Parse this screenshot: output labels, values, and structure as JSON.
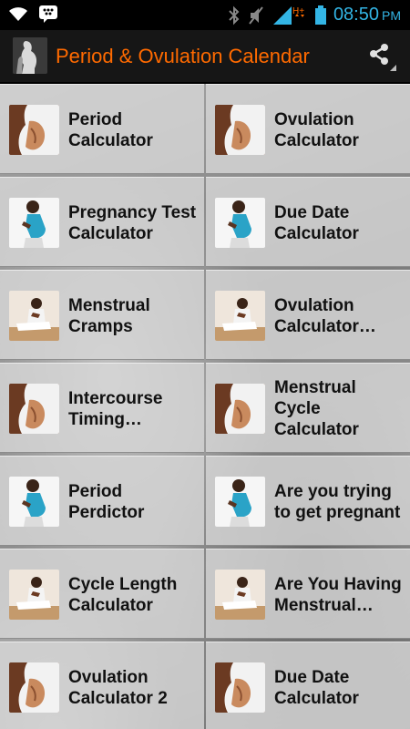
{
  "status_bar": {
    "time": "08:50",
    "ampm": "PM",
    "network": "H+",
    "icons": [
      "wifi-icon",
      "bbm-icon",
      "bluetooth-icon",
      "mute-icon",
      "signal-icon",
      "battery-icon"
    ]
  },
  "action_bar": {
    "title": "Period & Ovulation Calendar",
    "share_icon": "share-icon"
  },
  "colors": {
    "title": "#ff6a00",
    "clock": "#33b5e5",
    "tile_bg": "#d7d7d7"
  },
  "tiles": [
    {
      "label": "Period\nCalculator",
      "image": "belly-photo"
    },
    {
      "label": "Ovulation\nCalculator",
      "image": "belly-photo"
    },
    {
      "label": "Pregnancy Test\nCalculator",
      "image": "pregnant-woman-photo"
    },
    {
      "label": "Due Date\nCalculator",
      "image": "pregnant-woman-photo"
    },
    {
      "label": "Menstrual\nCramps",
      "image": "woman-sitting-photo"
    },
    {
      "label": "Ovulation\nCalculator…",
      "image": "woman-sitting-photo"
    },
    {
      "label": "Intercourse\nTiming…",
      "image": "belly-photo"
    },
    {
      "label": "Menstrual Cycle\nCalculator",
      "image": "belly-photo"
    },
    {
      "label": "Period Perdictor",
      "image": "pregnant-woman-photo"
    },
    {
      "label": "Are you trying\nto get pregnant",
      "image": "pregnant-woman-photo"
    },
    {
      "label": "Cycle Length\nCalculator",
      "image": "woman-sitting-photo"
    },
    {
      "label": "Are You Having\nMenstrual…",
      "image": "woman-sitting-photo"
    },
    {
      "label": "Ovulation\nCalculator 2",
      "image": "belly-photo"
    },
    {
      "label": "Due Date\nCalculator",
      "image": "belly-photo"
    }
  ]
}
